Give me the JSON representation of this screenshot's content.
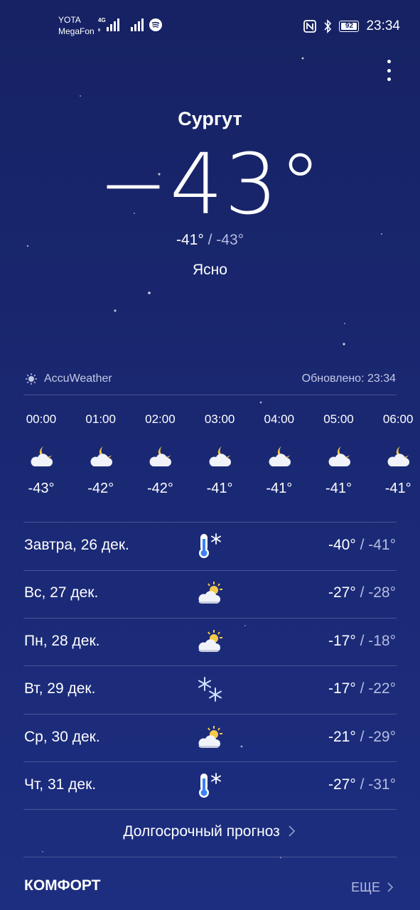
{
  "status_bar": {
    "carrier_1": "YOTA",
    "carrier_2": "MegaFon",
    "network": "4G",
    "battery": "92",
    "time": "23:34"
  },
  "location": {
    "city": "Сургут"
  },
  "current": {
    "temperature": "−43°",
    "high": "-41°",
    "separator": "/",
    "low": "-43°",
    "condition": "Ясно"
  },
  "source": {
    "name": "AccuWeather",
    "updated": "Обновлено: 23:34"
  },
  "hourly": [
    {
      "time": "00:00",
      "icon": "moon-cloud-icon",
      "temp": "-43°"
    },
    {
      "time": "01:00",
      "icon": "moon-cloud-icon",
      "temp": "-42°"
    },
    {
      "time": "02:00",
      "icon": "moon-cloud-icon",
      "temp": "-42°"
    },
    {
      "time": "03:00",
      "icon": "moon-cloud-icon",
      "temp": "-41°"
    },
    {
      "time": "04:00",
      "icon": "moon-cloud-icon",
      "temp": "-41°"
    },
    {
      "time": "05:00",
      "icon": "moon-cloud-icon",
      "temp": "-41°"
    },
    {
      "time": "06:00",
      "icon": "moon-cloud-icon",
      "temp": "-41°"
    }
  ],
  "daily": [
    {
      "label": "Завтра, 26 дек.",
      "icon": "cold-thermometer-icon",
      "high": "-40°",
      "low": "/ -41°"
    },
    {
      "label": "Вс, 27 дек.",
      "icon": "sun-cloud-icon",
      "high": "-27°",
      "low": "/ -28°"
    },
    {
      "label": "Пн, 28 дек.",
      "icon": "sun-cloud-icon",
      "high": "-17°",
      "low": "/ -18°"
    },
    {
      "label": "Вт, 29 дек.",
      "icon": "snowflakes-icon",
      "high": "-17°",
      "low": "/ -22°"
    },
    {
      "label": "Ср, 30 дек.",
      "icon": "sun-cloud-icon",
      "high": "-21°",
      "low": "/ -29°"
    },
    {
      "label": "Чт, 31 дек.",
      "icon": "cold-thermometer-icon",
      "high": "-27°",
      "low": "/ -31°"
    }
  ],
  "links": {
    "long_forecast": "Долгосрочный прогноз",
    "comfort": "КОМФОРТ",
    "more": "ЕЩЕ"
  },
  "colors": {
    "bg_top": "#162263",
    "bg_bottom": "#1d2e80",
    "muted": "#b6bde0"
  }
}
